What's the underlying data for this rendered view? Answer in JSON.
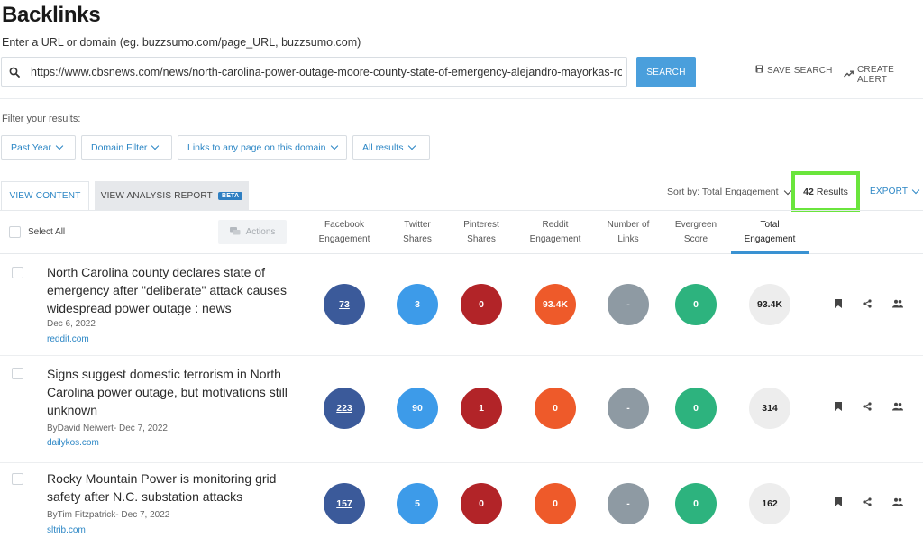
{
  "page": {
    "title": "Backlinks",
    "subtitle": "Enter a URL or domain (eg. buzzsumo.com/page_URL, buzzsumo.com)"
  },
  "search": {
    "value": "https://www.cbsnews.com/news/north-carolina-power-outage-moore-county-state-of-emergency-alejandro-mayorkas-roy-coo...",
    "button_label": "SEARCH"
  },
  "top_actions": {
    "save_search": "SAVE SEARCH",
    "create_alert": "CREATE ALERT"
  },
  "filters": {
    "label": "Filter your results:",
    "time": "Past Year",
    "domain": "Domain Filter",
    "links": "Links to any page on this domain",
    "results": "All results"
  },
  "tabs": {
    "view_content": "VIEW CONTENT",
    "view_analysis": "VIEW ANALYSIS REPORT",
    "beta": "BETA"
  },
  "toolbar": {
    "sort_label": "Sort by: Total Engagement",
    "results_count": "42",
    "results_word": "Results",
    "export_label": "EXPORT"
  },
  "table": {
    "select_all": "Select All",
    "actions_label": "Actions",
    "columns": [
      {
        "line1": "Facebook",
        "line2": "Engagement"
      },
      {
        "line1": "Twitter",
        "line2": "Shares"
      },
      {
        "line1": "Pinterest",
        "line2": "Shares"
      },
      {
        "line1": "Reddit",
        "line2": "Engagement"
      },
      {
        "line1": "Number of",
        "line2": "Links"
      },
      {
        "line1": "Evergreen",
        "line2": "Score"
      },
      {
        "line1": "Total",
        "line2": "Engagement"
      }
    ],
    "rows": [
      {
        "title": "North Carolina county declares state of emergency after \"deliberate\" attack causes widespread power outage : news",
        "meta": "Dec 6, 2022",
        "source": "reddit.com",
        "facebook": "73",
        "twitter": "3",
        "pinterest": "0",
        "reddit": "93.4K",
        "links": "-",
        "evergreen": "0",
        "total": "93.4K"
      },
      {
        "title": "Signs suggest domestic terrorism in North Carolina power outage, but motivations still unknown",
        "meta": "ByDavid Neiwert- Dec 7, 2022",
        "source": "dailykos.com",
        "facebook": "223",
        "twitter": "90",
        "pinterest": "1",
        "reddit": "0",
        "links": "-",
        "evergreen": "0",
        "total": "314"
      },
      {
        "title": "Rocky Mountain Power is monitoring grid safety after N.C. substation attacks",
        "meta": "ByTim Fitzpatrick- Dec 7, 2022",
        "source": "sltrib.com",
        "facebook": "157",
        "twitter": "5",
        "pinterest": "0",
        "reddit": "0",
        "links": "-",
        "evergreen": "0",
        "total": "162"
      }
    ]
  },
  "colors": {
    "facebook": "#3b5a9a",
    "twitter": "#3d9be9",
    "pinterest": "#b22428",
    "reddit": "#ee5a2a",
    "links": "#8e9aa3",
    "evergreen": "#2db37e",
    "accent": "#2b86c5",
    "highlight": "#6ae53c"
  },
  "icons": {
    "search": "search-icon",
    "save": "save-icon",
    "alert": "trend-icon",
    "bookmark": "bookmark-icon",
    "share": "share-icon",
    "people": "people-icon",
    "chat": "chat-icon"
  }
}
